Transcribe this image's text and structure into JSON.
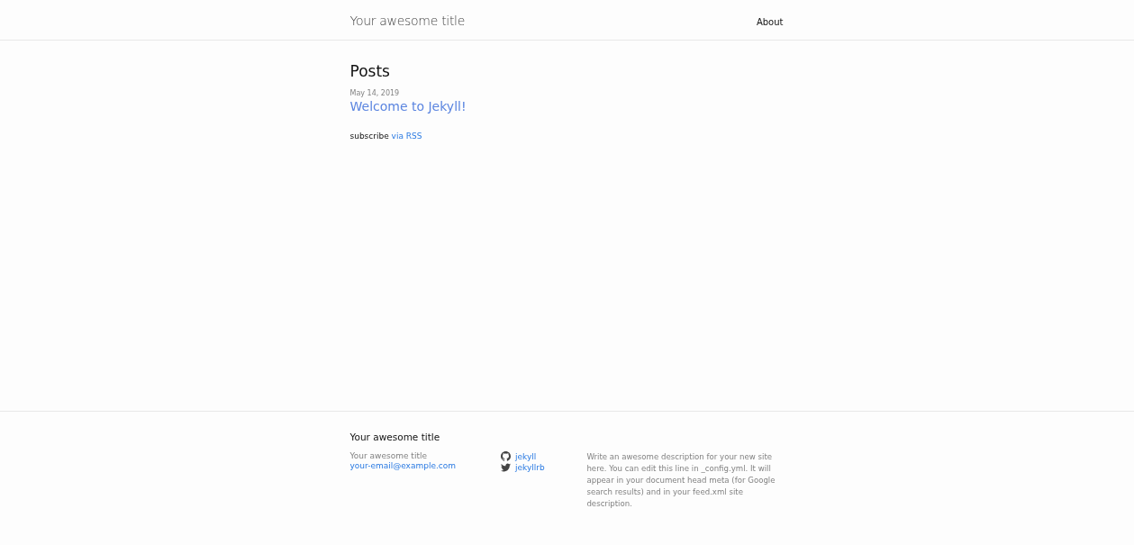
{
  "header": {
    "site_title": "Your awesome title",
    "nav": [
      {
        "label": "About"
      }
    ]
  },
  "main": {
    "heading": "Posts",
    "posts": [
      {
        "date": "May 14, 2019",
        "title": "Welcome to Jekyll!"
      }
    ],
    "subscribe": {
      "text": "subscribe",
      "link": "via RSS"
    }
  },
  "footer": {
    "heading": "Your awesome title",
    "contact": {
      "name": "Your awesome title",
      "email": "your-email@example.com"
    },
    "social": [
      {
        "kind": "github",
        "label": "jekyll"
      },
      {
        "kind": "twitter",
        "label": "jekyllrb"
      }
    ],
    "description": "Write an awesome description for your new site here. You can edit this line in _config.yml. It will appear in your document head meta (for Google search results) and in your feed.xml site description."
  }
}
